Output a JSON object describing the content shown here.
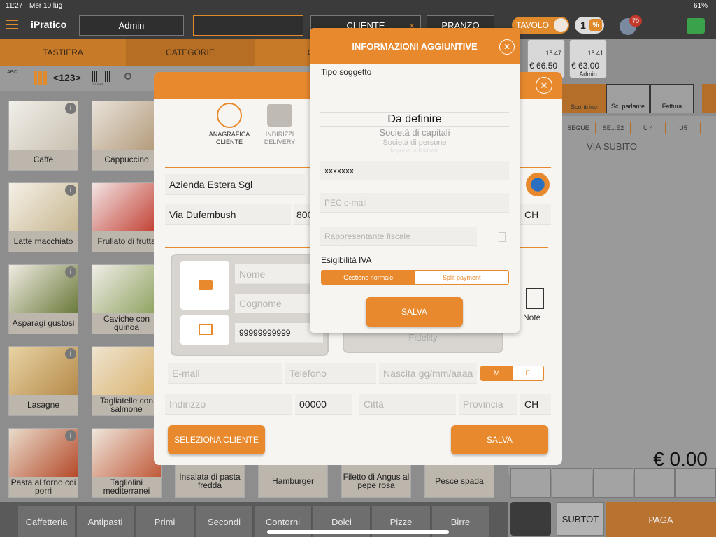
{
  "status": {
    "time": "11:27",
    "date": "Mer 10 lug",
    "battery": "61%"
  },
  "topbar": {
    "brand": "iPratico",
    "operator": "Admin",
    "cliente": "CLIENTE",
    "cliente_clear": "×",
    "service": "PRANZO",
    "tavolo": "TAVOLO",
    "covers": "1",
    "percent": "%",
    "notifications": "70"
  },
  "tabs": [
    "TASTIERA",
    "CATEGORIE",
    "C"
  ],
  "toolbar": {
    "numeric": "<123>",
    "barcode_digits": "1 2 3 4 5",
    "abc": "ABC"
  },
  "products": [
    {
      "name": "Caffe"
    },
    {
      "name": "Cappuccino"
    },
    {
      "name": "Latte macchiato"
    },
    {
      "name": "Frullato di frutta"
    },
    {
      "name": "Asparagi gustosi"
    },
    {
      "name": "Caviche con quinoa"
    },
    {
      "name": "Lasagne"
    },
    {
      "name": "Tagliatelle con salmone"
    },
    {
      "name": "Pasta al forno coi porri"
    },
    {
      "name": "Tagliolini mediterranei"
    },
    {
      "name": "Insalata di pasta fredda"
    },
    {
      "name": "Hamburger"
    },
    {
      "name": "Filetto di Angus al pepe rosa"
    },
    {
      "name": "Pesce spada"
    }
  ],
  "info_glyph": "i",
  "categories": [
    "Caffetteria",
    "Antipasti",
    "Primi",
    "Secondi",
    "Contorni",
    "Dolci",
    "Pizze",
    "Birre"
  ],
  "right": {
    "cards": [
      {
        "time": "15:47",
        "amount": "€ 66.50",
        "user": ""
      },
      {
        "time": "15:41",
        "amount": "€ 63.00",
        "user": "Admin"
      }
    ],
    "doc_buttons": [
      "Scontrino",
      "Sc. parlante",
      "Fattura"
    ],
    "courses": [
      "SEGUE",
      "SE...E2",
      "U 4",
      "U5"
    ],
    "via_subito": "VIA SUBITO",
    "total": "€ 0.00",
    "subtot": "SUBTOT",
    "paga": "PAGA"
  },
  "modal": {
    "tab_anagrafica": "ANAGRAFICA CLIENTE",
    "tab_indirizzi": "INDIRIZZI DELIVERY",
    "company": "Azienda Estera Sgl",
    "street": "Via Dufembush",
    "street_no": "800",
    "country_code": "CH",
    "nome_ph": "Nome",
    "cognome_ph": "Cognome",
    "phone_value": "99999999999",
    "fidelity": "Fidelity",
    "note": "Note",
    "email_ph": "E-mail",
    "telefono_ph": "Telefono",
    "nascita_ph": "Nascita gg/mm/aaaa",
    "gender_m": "M",
    "gender_f": "F",
    "indirizzo_ph": "Indirizzo",
    "cap_value": "00000",
    "citta_ph": "Città",
    "provincia_ph": "Provincia",
    "country2": "CH",
    "seleziona": "SELEZIONA CLIENTE",
    "salva": "SALVA",
    "close": "✕"
  },
  "modal2": {
    "title": "INFORMAZIONI AGGIUNTIVE",
    "close": "✕",
    "tipo_label": "Tipo soggetto",
    "picker": [
      "Da definire",
      "Società di capitali",
      "Società di persone",
      "Impresa individuale"
    ],
    "code_value": "xxxxxxx",
    "pec_ph": "PEC e-mail",
    "rappr_ph": "Rappresentante fiscale",
    "esigibilita_label": "Esigibilità IVA",
    "seg_normale": "Gestione normale",
    "seg_split": "Split payment",
    "salva": "SALVA"
  }
}
